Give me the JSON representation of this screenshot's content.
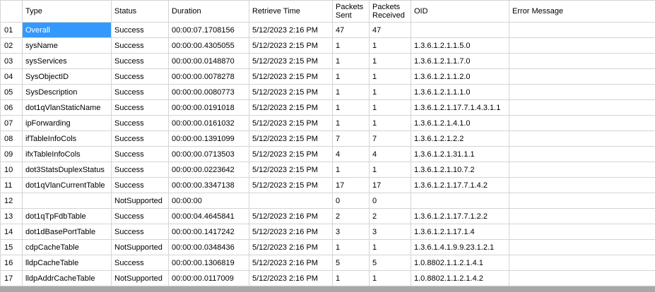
{
  "columns": {
    "type": "Type",
    "status": "Status",
    "duration": "Duration",
    "retrieve_time": "Retrieve Time",
    "packets_sent_1": "Packets",
    "packets_sent_2": "Sent",
    "packets_received_1": "Packets",
    "packets_received_2": "Received",
    "oid": "OID",
    "error_message": "Error Message"
  },
  "rows": [
    {
      "num": "01",
      "type": "Overall",
      "status": "Success",
      "duration": "00:00:07.1708156",
      "time": "5/12/2023 2:16 PM",
      "sent": "47",
      "received": "47",
      "oid": "",
      "error": ""
    },
    {
      "num": "02",
      "type": "sysName",
      "status": "Success",
      "duration": "00:00:00.4305055",
      "time": "5/12/2023 2:15 PM",
      "sent": "1",
      "received": "1",
      "oid": "1.3.6.1.2.1.1.5.0",
      "error": ""
    },
    {
      "num": "03",
      "type": "sysServices",
      "status": "Success",
      "duration": "00:00:00.0148870",
      "time": "5/12/2023 2:15 PM",
      "sent": "1",
      "received": "1",
      "oid": "1.3.6.1.2.1.1.7.0",
      "error": ""
    },
    {
      "num": "04",
      "type": "SysObjectID",
      "status": "Success",
      "duration": "00:00:00.0078278",
      "time": "5/12/2023 2:15 PM",
      "sent": "1",
      "received": "1",
      "oid": "1.3.6.1.2.1.1.2.0",
      "error": ""
    },
    {
      "num": "05",
      "type": "SysDescription",
      "status": "Success",
      "duration": "00:00:00.0080773",
      "time": "5/12/2023 2:15 PM",
      "sent": "1",
      "received": "1",
      "oid": "1.3.6.1.2.1.1.1.0",
      "error": ""
    },
    {
      "num": "06",
      "type": "dot1qVlanStaticName",
      "status": "Success",
      "duration": "00:00:00.0191018",
      "time": "5/12/2023 2:15 PM",
      "sent": "1",
      "received": "1",
      "oid": "1.3.6.1.2.1.17.7.1.4.3.1.1",
      "error": ""
    },
    {
      "num": "07",
      "type": "ipForwarding",
      "status": "Success",
      "duration": "00:00:00.0161032",
      "time": "5/12/2023 2:15 PM",
      "sent": "1",
      "received": "1",
      "oid": "1.3.6.1.2.1.4.1.0",
      "error": ""
    },
    {
      "num": "08",
      "type": "ifTableInfoCols",
      "status": "Success",
      "duration": "00:00:00.1391099",
      "time": "5/12/2023 2:15 PM",
      "sent": "7",
      "received": "7",
      "oid": "1.3.6.1.2.1.2.2",
      "error": ""
    },
    {
      "num": "09",
      "type": "ifxTableInfoCols",
      "status": "Success",
      "duration": "00:00:00.0713503",
      "time": "5/12/2023 2:15 PM",
      "sent": "4",
      "received": "4",
      "oid": "1.3.6.1.2.1.31.1.1",
      "error": ""
    },
    {
      "num": "10",
      "type": "dot3StatsDuplexStatus",
      "status": "Success",
      "duration": "00:00:00.0223642",
      "time": "5/12/2023 2:15 PM",
      "sent": "1",
      "received": "1",
      "oid": "1.3.6.1.2.1.10.7.2",
      "error": ""
    },
    {
      "num": "11",
      "type": "dot1qVlanCurrentTable",
      "status": "Success",
      "duration": "00:00:00.3347138",
      "time": "5/12/2023 2:15 PM",
      "sent": "17",
      "received": "17",
      "oid": "1.3.6.1.2.1.17.7.1.4.2",
      "error": ""
    },
    {
      "num": "12",
      "type": "",
      "status": "NotSupported",
      "duration": "00:00:00",
      "time": "",
      "sent": "0",
      "received": "0",
      "oid": "",
      "error": ""
    },
    {
      "num": "13",
      "type": "dot1qTpFdbTable",
      "status": "Success",
      "duration": "00:00:04.4645841",
      "time": "5/12/2023 2:16 PM",
      "sent": "2",
      "received": "2",
      "oid": "1.3.6.1.2.1.17.7.1.2.2",
      "error": ""
    },
    {
      "num": "14",
      "type": "dot1dBasePortTable",
      "status": "Success",
      "duration": "00:00:00.1417242",
      "time": "5/12/2023 2:16 PM",
      "sent": "3",
      "received": "3",
      "oid": "1.3.6.1.2.1.17.1.4",
      "error": ""
    },
    {
      "num": "15",
      "type": "cdpCacheTable",
      "status": "NotSupported",
      "duration": "00:00:00.0348436",
      "time": "5/12/2023 2:16 PM",
      "sent": "1",
      "received": "1",
      "oid": "1.3.6.1.4.1.9.9.23.1.2.1",
      "error": ""
    },
    {
      "num": "16",
      "type": "lldpCacheTable",
      "status": "Success",
      "duration": "00:00:00.1306819",
      "time": "5/12/2023 2:16 PM",
      "sent": "5",
      "received": "5",
      "oid": "1.0.8802.1.1.2.1.4.1",
      "error": ""
    },
    {
      "num": "17",
      "type": "lldpAddrCacheTable",
      "status": "NotSupported",
      "duration": "00:00:00.0117009",
      "time": "5/12/2023 2:16 PM",
      "sent": "1",
      "received": "1",
      "oid": "1.0.8802.1.1.2.1.4.2",
      "error": ""
    }
  ],
  "colors": {
    "selection": "#3399ff",
    "gridline": "#d4d4d4",
    "scrollbar": "#a8a8a8"
  }
}
